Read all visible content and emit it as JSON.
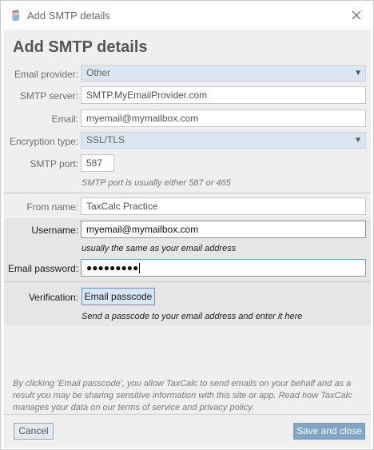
{
  "window": {
    "title": "Add SMTP details",
    "app_icon": "book-icon",
    "close_icon": "close-icon"
  },
  "heading": "Add SMTP details",
  "form": {
    "email_provider": {
      "label": "Email provider:",
      "value": "Other"
    },
    "smtp_server": {
      "label": "SMTP server:",
      "value": "SMTP.MyEmailProvider.com"
    },
    "email": {
      "label": "Email:",
      "value": "myemail@mymailbox.com"
    },
    "encryption_type": {
      "label": "Encryption type:",
      "value": "SSL/TLS"
    },
    "smtp_port": {
      "label": "SMTP port:",
      "value": "587",
      "hint": "SMTP port is usually either 587 or 465"
    },
    "from_name": {
      "label": "From name:",
      "value": "TaxCalc Practice"
    },
    "username": {
      "label": "Username:",
      "value": "myemail@mymailbox.com",
      "hint": "usually the same as your email address"
    },
    "email_password": {
      "label": "Email password:",
      "value": "●●●●●●●●●"
    },
    "verification": {
      "label": "Verification:",
      "button": "Email passcode",
      "hint": "Send a passcode to your email address and enter it here"
    }
  },
  "disclaimer": "By clicking 'Email passcode', you allow TaxCalc to send emails on your behalf and as a result you may be sharing sensitive information with this site or app. Read how TaxCalc manages your data on our terms of service and privacy policy.",
  "footer": {
    "cancel_label": "Cancel",
    "save_label": "Save and close"
  },
  "colors": {
    "select_bg": "#d9e6f0",
    "primary_button": "#7fa6c6",
    "focus_border": "#5ea4d7"
  }
}
